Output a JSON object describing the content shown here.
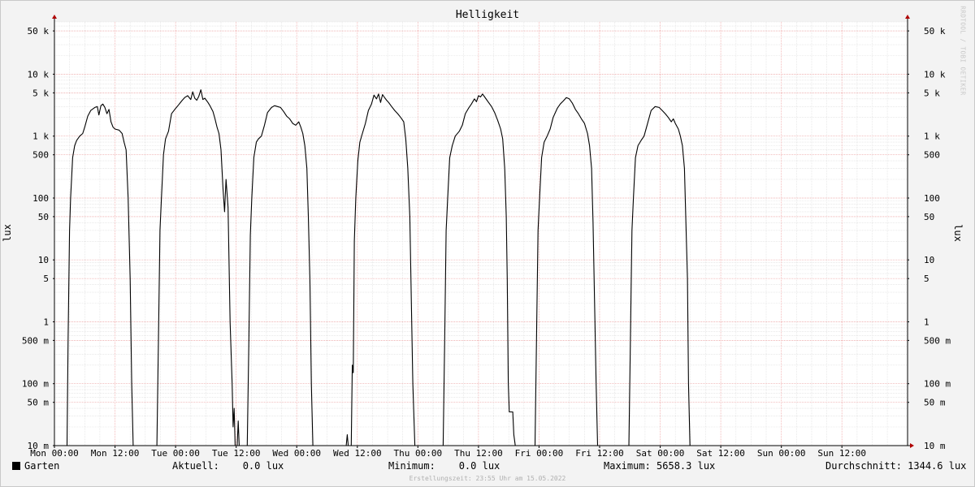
{
  "colors": {
    "background": "#f3f3f3",
    "plot_background": "#ffffff",
    "grid_minor": "#dcdcdc",
    "grid_major": "#f0a0a0",
    "series": "#000000",
    "axis": "#000000",
    "axis_arrow": "#b00000"
  },
  "watermark": "RRDTOOL / TOBI OETIKER",
  "legend": {
    "series_name": "Garten",
    "aktuell": "Aktuell:    0.0 lux",
    "minimum": "Minimum:    0.0 lux",
    "maximum": "Maximum: 5658.3 lux",
    "durchschnitt": "Durchschnitt: 1344.6 lux"
  },
  "footer": "Erstellungszeit: 23:55 Uhr am 15.05.2022",
  "chart_data": {
    "type": "line",
    "title": "Helligkeit",
    "ylabel": "lux",
    "yscale": "log",
    "ylim": [
      0.01,
      70000
    ],
    "xlim": [
      0,
      169
    ],
    "grid": true,
    "x_tick_hours": [
      0,
      12,
      24,
      36,
      48,
      60,
      72,
      84,
      96,
      108,
      120,
      132,
      144,
      156
    ],
    "x_tick_labels": [
      "Mon 00:00",
      "Mon 12:00",
      "Tue 00:00",
      "Tue 12:00",
      "Wed 00:00",
      "Wed 12:00",
      "Thu 00:00",
      "Thu 12:00",
      "Fri 00:00",
      "Fri 12:00",
      "Sat 00:00",
      "Sat 12:00",
      "Sun 00:00",
      "Sun 12:00"
    ],
    "y_ticks": [
      0.01,
      0.05,
      0.1,
      0.5,
      1,
      5,
      10,
      50,
      100,
      500,
      1000,
      5000,
      10000,
      50000
    ],
    "y_tick_labels": [
      "10 m",
      "50 m",
      "100 m",
      "500 m",
      "1",
      "5",
      "10",
      "50",
      "100",
      "500",
      "1 k",
      "5 k",
      "10 k",
      "50 k"
    ],
    "series": [
      {
        "name": "Garten",
        "x_unit": "hours since Mon 00:00",
        "points": [
          [
            0,
            0.01
          ],
          [
            2.5,
            0.01
          ],
          [
            2.7,
            0.5
          ],
          [
            3,
            30
          ],
          [
            3.2,
            100
          ],
          [
            3.6,
            450
          ],
          [
            4,
            700
          ],
          [
            4.4,
            850
          ],
          [
            5,
            1000
          ],
          [
            5.6,
            1100
          ],
          [
            6,
            1400
          ],
          [
            6.6,
            2100
          ],
          [
            7.2,
            2600
          ],
          [
            8,
            2900
          ],
          [
            8.5,
            3000
          ],
          [
            8.8,
            2200
          ],
          [
            9.2,
            3100
          ],
          [
            9.6,
            3300
          ],
          [
            10,
            2900
          ],
          [
            10.4,
            2300
          ],
          [
            10.8,
            2700
          ],
          [
            11.2,
            1700
          ],
          [
            11.6,
            1400
          ],
          [
            12,
            1300
          ],
          [
            12.8,
            1250
          ],
          [
            13.4,
            1100
          ],
          [
            13.8,
            800
          ],
          [
            14.2,
            600
          ],
          [
            14.6,
            100
          ],
          [
            15,
            5
          ],
          [
            15.3,
            0.1
          ],
          [
            15.6,
            0.01
          ],
          [
            20.3,
            0.01
          ],
          [
            20.6,
            0.5
          ],
          [
            20.9,
            30
          ],
          [
            21.2,
            100
          ],
          [
            21.6,
            500
          ],
          [
            22,
            900
          ],
          [
            22.6,
            1200
          ],
          [
            23.2,
            2300
          ],
          [
            24,
            2800
          ],
          [
            24.6,
            3200
          ],
          [
            25.2,
            3700
          ],
          [
            25.8,
            4200
          ],
          [
            26.4,
            4500
          ],
          [
            27,
            3900
          ],
          [
            27.4,
            5200
          ],
          [
            27.8,
            4100
          ],
          [
            28.2,
            3800
          ],
          [
            28.6,
            4400
          ],
          [
            29,
            5600
          ],
          [
            29.4,
            3900
          ],
          [
            29.8,
            4100
          ],
          [
            30.4,
            3500
          ],
          [
            30.8,
            3100
          ],
          [
            31.4,
            2500
          ],
          [
            31.8,
            1900
          ],
          [
            32.2,
            1400
          ],
          [
            32.6,
            1100
          ],
          [
            33,
            600
          ],
          [
            33.4,
            140
          ],
          [
            33.7,
            60
          ],
          [
            34,
            200
          ],
          [
            34.4,
            70
          ],
          [
            34.8,
            1
          ],
          [
            35.2,
            0.1
          ],
          [
            35.4,
            0.02
          ],
          [
            35.6,
            0.04
          ],
          [
            35.8,
            0.01
          ],
          [
            36.2,
            0.01
          ],
          [
            36.4,
            0.025
          ],
          [
            36.6,
            0.01
          ],
          [
            38.2,
            0.01
          ],
          [
            38.5,
            0.4
          ],
          [
            38.8,
            25
          ],
          [
            39.1,
            100
          ],
          [
            39.5,
            450
          ],
          [
            40,
            800
          ],
          [
            40.4,
            900
          ],
          [
            41,
            1000
          ],
          [
            41.6,
            1500
          ],
          [
            42.2,
            2400
          ],
          [
            43,
            2900
          ],
          [
            43.6,
            3100
          ],
          [
            44.2,
            3000
          ],
          [
            44.8,
            2900
          ],
          [
            45.4,
            2500
          ],
          [
            46,
            2100
          ],
          [
            46.6,
            1900
          ],
          [
            47.2,
            1600
          ],
          [
            47.8,
            1500
          ],
          [
            48.4,
            1700
          ],
          [
            48.8,
            1400
          ],
          [
            49.2,
            1100
          ],
          [
            49.6,
            700
          ],
          [
            50,
            300
          ],
          [
            50.3,
            50
          ],
          [
            50.6,
            5
          ],
          [
            50.9,
            0.1
          ],
          [
            51.2,
            0.01
          ],
          [
            57.8,
            0.01
          ],
          [
            58,
            0.015
          ],
          [
            58.2,
            0.01
          ],
          [
            58.8,
            0.01
          ],
          [
            59,
            0.2
          ],
          [
            59.2,
            0.15
          ],
          [
            59.4,
            20
          ],
          [
            59.7,
            100
          ],
          [
            60.1,
            400
          ],
          [
            60.5,
            800
          ],
          [
            61,
            1100
          ],
          [
            61.6,
            1600
          ],
          [
            62.2,
            2600
          ],
          [
            62.8,
            3300
          ],
          [
            63.3,
            4600
          ],
          [
            63.8,
            4000
          ],
          [
            64.2,
            4800
          ],
          [
            64.6,
            3500
          ],
          [
            65,
            4700
          ],
          [
            65.4,
            4200
          ],
          [
            65.8,
            3800
          ],
          [
            66.2,
            3500
          ],
          [
            66.8,
            3000
          ],
          [
            67.4,
            2600
          ],
          [
            68,
            2300
          ],
          [
            68.6,
            2000
          ],
          [
            69.2,
            1700
          ],
          [
            69.6,
            900
          ],
          [
            70,
            300
          ],
          [
            70.4,
            50
          ],
          [
            70.7,
            2
          ],
          [
            71,
            0.1
          ],
          [
            71.4,
            0.01
          ],
          [
            77,
            0.01
          ],
          [
            77.3,
            0.5
          ],
          [
            77.6,
            30
          ],
          [
            77.9,
            100
          ],
          [
            78.3,
            450
          ],
          [
            78.8,
            700
          ],
          [
            79.4,
            1000
          ],
          [
            80.2,
            1200
          ],
          [
            80.8,
            1500
          ],
          [
            81.4,
            2300
          ],
          [
            82,
            2800
          ],
          [
            82.6,
            3300
          ],
          [
            83.2,
            4000
          ],
          [
            83.6,
            3600
          ],
          [
            84,
            4500
          ],
          [
            84.4,
            4300
          ],
          [
            84.8,
            4800
          ],
          [
            85.4,
            4100
          ],
          [
            86,
            3500
          ],
          [
            86.6,
            3000
          ],
          [
            87.2,
            2400
          ],
          [
            87.8,
            1800
          ],
          [
            88.4,
            1300
          ],
          [
            88.8,
            900
          ],
          [
            89.2,
            300
          ],
          [
            89.5,
            50
          ],
          [
            89.7,
            5
          ],
          [
            89.9,
            0.1
          ],
          [
            90.1,
            0.035
          ],
          [
            90.8,
            0.035
          ],
          [
            91,
            0.015
          ],
          [
            91.3,
            0.01
          ],
          [
            95.2,
            0.01
          ],
          [
            95.5,
            0.5
          ],
          [
            95.8,
            30
          ],
          [
            96.1,
            100
          ],
          [
            96.5,
            450
          ],
          [
            97,
            800
          ],
          [
            97.6,
            1000
          ],
          [
            98.2,
            1300
          ],
          [
            98.8,
            2000
          ],
          [
            99.6,
            2800
          ],
          [
            100.2,
            3300
          ],
          [
            100.8,
            3700
          ],
          [
            101.4,
            4200
          ],
          [
            102,
            4000
          ],
          [
            102.6,
            3400
          ],
          [
            103.2,
            2700
          ],
          [
            103.8,
            2300
          ],
          [
            104.4,
            1900
          ],
          [
            105,
            1600
          ],
          [
            105.6,
            1100
          ],
          [
            106,
            700
          ],
          [
            106.4,
            300
          ],
          [
            106.7,
            40
          ],
          [
            107,
            2
          ],
          [
            107.3,
            0.1
          ],
          [
            107.6,
            0.01
          ],
          [
            113.8,
            0.01
          ],
          [
            114.1,
            0.5
          ],
          [
            114.4,
            30
          ],
          [
            114.7,
            100
          ],
          [
            115.1,
            450
          ],
          [
            115.6,
            700
          ],
          [
            116.2,
            850
          ],
          [
            116.8,
            1000
          ],
          [
            117.4,
            1500
          ],
          [
            118.2,
            2600
          ],
          [
            119,
            3000
          ],
          [
            119.8,
            2900
          ],
          [
            120.4,
            2600
          ],
          [
            121,
            2300
          ],
          [
            121.6,
            2000
          ],
          [
            122.2,
            1700
          ],
          [
            122.6,
            1900
          ],
          [
            123,
            1600
          ],
          [
            123.6,
            1300
          ],
          [
            124,
            1000
          ],
          [
            124.4,
            700
          ],
          [
            124.8,
            300
          ],
          [
            125.1,
            40
          ],
          [
            125.4,
            5
          ],
          [
            125.6,
            0.1
          ],
          [
            125.9,
            0.01
          ],
          [
            169,
            0.01
          ]
        ]
      }
    ]
  }
}
